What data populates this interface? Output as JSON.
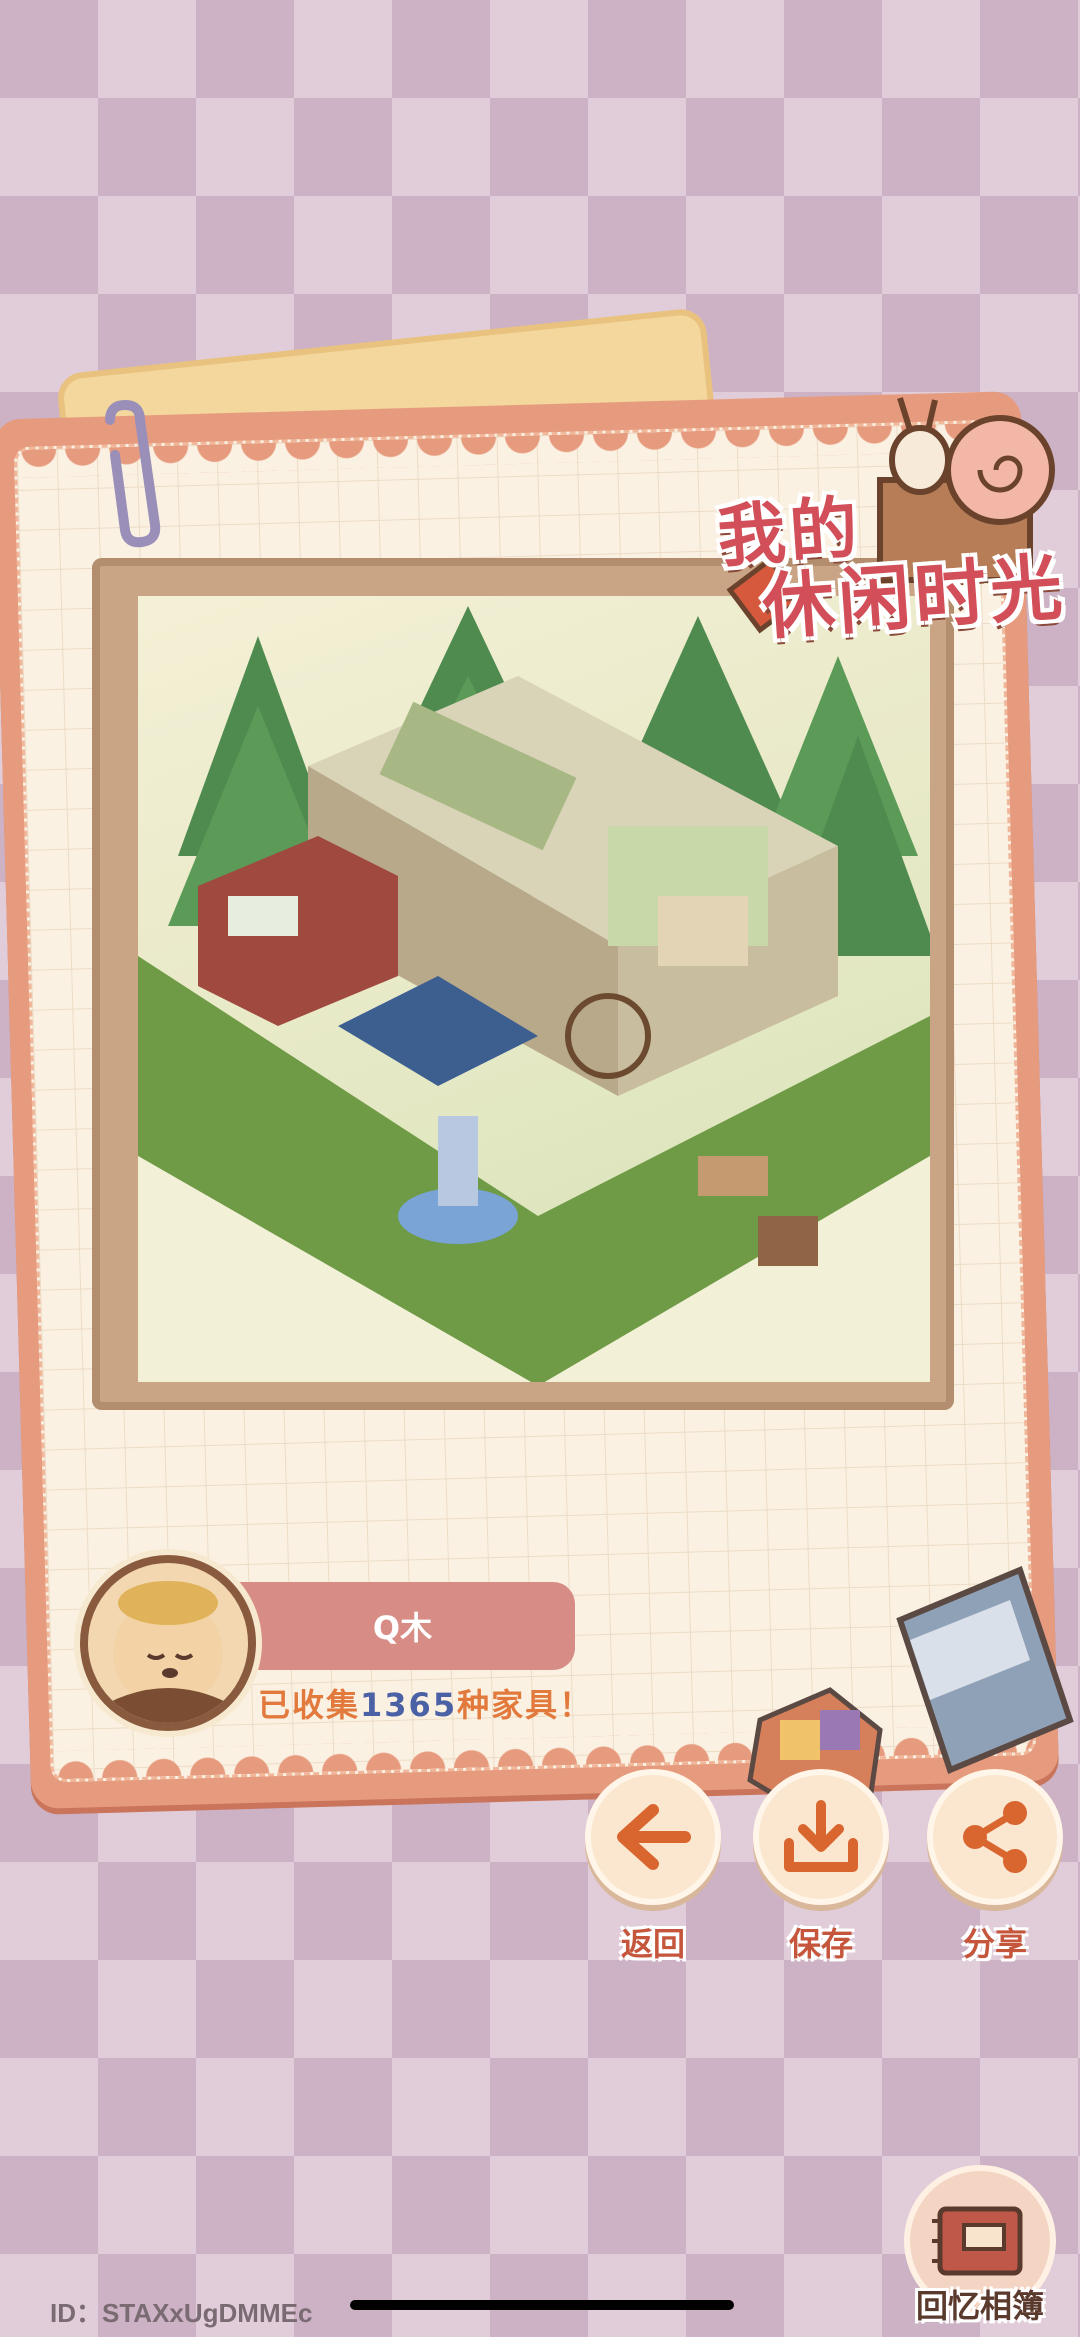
{
  "title": {
    "line1": "我的",
    "line2": "休闲时光"
  },
  "profile": {
    "name": "Q木",
    "collect_prefix": "已收集",
    "collect_count": "1365",
    "collect_suffix": "种家具！"
  },
  "actions": [
    {
      "label": "返回",
      "icon": "arrow-left-icon"
    },
    {
      "label": "保存",
      "icon": "download-icon"
    },
    {
      "label": "分享",
      "icon": "share-icon"
    }
  ],
  "memory": {
    "label": "回忆相簿",
    "icon": "album-icon"
  },
  "footer": {
    "id_text": "ID：STAXxUgDMMEc"
  },
  "colors": {
    "accent": "#d24e58",
    "label": "#c5553b",
    "collect_text": "#e27a3d",
    "collect_number": "#4a61a5"
  }
}
